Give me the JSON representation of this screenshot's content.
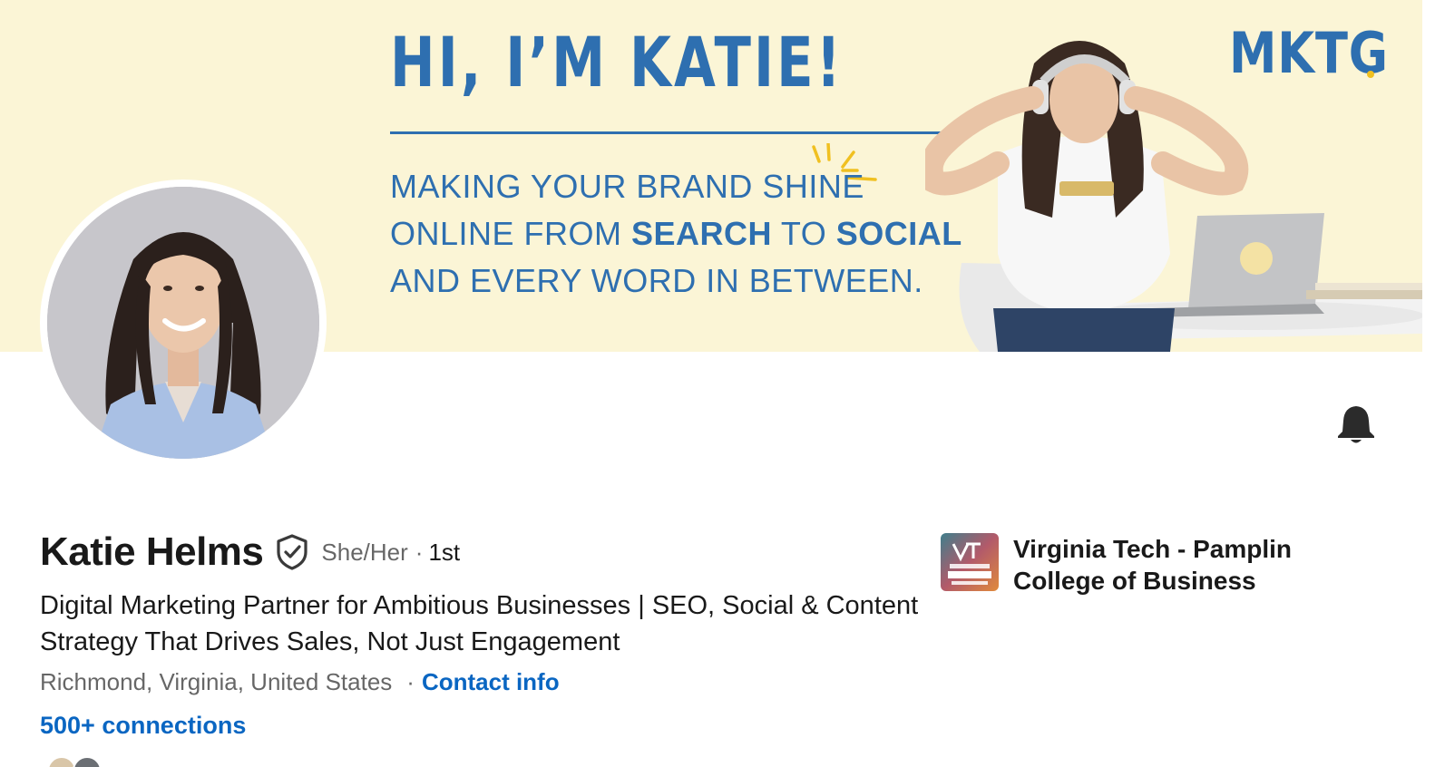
{
  "banner": {
    "headline": "HI, I’M KATIE!",
    "tagline_line1": "MAKING YOUR BRAND SHINE",
    "tagline_line2_pre": "ONLINE FROM ",
    "tagline_line2_bold1": "SEARCH",
    "tagline_line2_mid": " TO ",
    "tagline_line2_bold2": "SOCIAL",
    "tagline_line3": "AND EVERY WORD IN BETWEEN.",
    "logo_text": "MKTG",
    "brand_color": "#2e6fb0",
    "background_color": "#fbf5d6"
  },
  "profile": {
    "name": "Katie Helms",
    "pronouns": "She/Her",
    "separator": "·",
    "degree": "1st",
    "headline": "Digital Marketing Partner for Ambitious Businesses | SEO, Social & Content Strategy That Drives Sales, Not Just Engagement",
    "location": "Richmond, Virginia, United States",
    "location_separator": "·",
    "contact_info": "Contact info",
    "connections": "500+ connections",
    "verified_icon": "shield-check-icon",
    "notification_icon": "bell-icon"
  },
  "education": {
    "name": "Virginia Tech - Pamplin College of Business",
    "logo_icon": "virginia-tech-pamplin-logo"
  },
  "colors": {
    "link": "#0a66c2",
    "text_primary": "#191919",
    "text_secondary": "#666666"
  }
}
